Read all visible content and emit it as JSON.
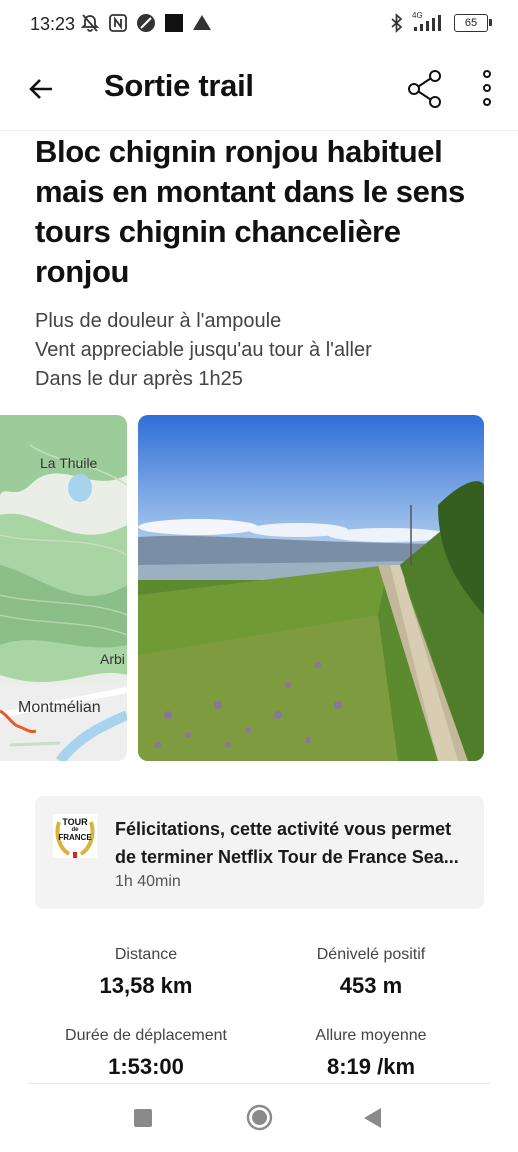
{
  "status_bar": {
    "time": "13:23",
    "network": "4G",
    "battery": "65"
  },
  "app_bar": {
    "title": "Sortie trail"
  },
  "activity": {
    "title": "Bloc chignin ronjou habituel mais en montant dans le sens tours chignin chancelière ronjou",
    "description_lines": [
      "Plus de douleur à l'ampoule",
      "Vent appreciable jusqu'au tour à l'aller",
      "Dans le dur après 1h25"
    ]
  },
  "map": {
    "labels": [
      "La Thuile",
      "Arbi",
      "Montmélian"
    ]
  },
  "achievement": {
    "badge_text_top": "TOUR",
    "badge_text_mid": "de",
    "badge_text_bottom": "FRANCE",
    "line1": "Félicitations, cette activité vous permet",
    "line2": "de terminer Netflix Tour de France Sea...",
    "duration": "1h 40min"
  },
  "stats": [
    {
      "label": "Distance",
      "value": "13,58 km"
    },
    {
      "label": "Dénivelé positif",
      "value": "453 m"
    },
    {
      "label": "Durée de déplacement",
      "value": "1:53:00"
    },
    {
      "label": "Allure moyenne",
      "value": "8:19 /km"
    }
  ],
  "colors": {
    "route": "#e85a2a",
    "card_bg": "#f3f3f3",
    "badge_gold": "#d9b43c"
  }
}
